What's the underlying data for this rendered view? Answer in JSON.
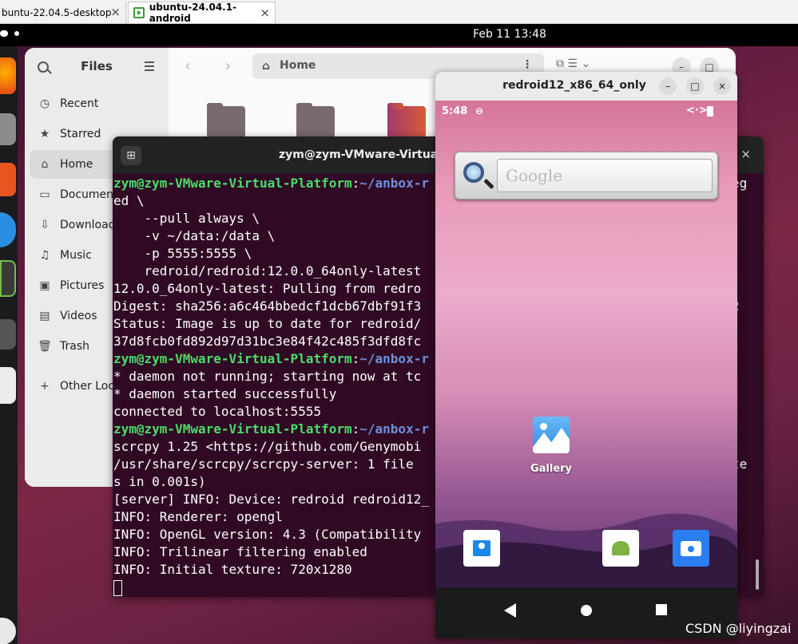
{
  "vmware_tabs": [
    {
      "label": "buntu-22.04.5-desktop",
      "close": "×"
    },
    {
      "label": "ubuntu-24.04.1-android",
      "close": "×"
    }
  ],
  "topbar": {
    "clock": "Feb 11  13:48"
  },
  "files": {
    "title": "Files",
    "path": "Home",
    "path_menu": "⋮",
    "nav": "‹ ›",
    "view_buttons": "⧉   ☰ ⌄",
    "sidebar": [
      {
        "icon": "recent-icon",
        "glyph": "◷",
        "label": "Recent"
      },
      {
        "icon": "star-icon",
        "glyph": "★",
        "label": "Starred"
      },
      {
        "icon": "home-icon",
        "glyph": "⌂",
        "label": "Home"
      },
      {
        "icon": "document-icon",
        "glyph": "▭",
        "label": "Documen"
      },
      {
        "icon": "download-icon",
        "glyph": "⇩",
        "label": "Download"
      },
      {
        "icon": "music-icon",
        "glyph": "♫",
        "label": "Music"
      },
      {
        "icon": "pictures-icon",
        "glyph": "▣",
        "label": "Pictures"
      },
      {
        "icon": "videos-icon",
        "glyph": "▤",
        "label": "Videos"
      },
      {
        "icon": "trash-icon",
        "glyph": "🗑",
        "label": "Trash"
      },
      {
        "icon": "plus-icon",
        "glyph": "+",
        "label": "Other Loc"
      }
    ],
    "window_buttons": {
      "minimize": "–",
      "maximize": "□",
      "close": "×"
    }
  },
  "terminal": {
    "title": "zym@zym-VMware-Virtual-P",
    "new_tab": "⊞",
    "close": "×",
    "lines": [
      {
        "prompt": "zym@zym-VMware-Virtual-Platform",
        "sep": ":",
        "dir": "~/anbox-r",
        "text": ""
      },
      {
        "text": "ed \\"
      },
      {
        "text": "    --pull always \\"
      },
      {
        "text": "    -v ~/data:/data \\"
      },
      {
        "text": "    -p 5555:5555 \\"
      },
      {
        "text": "    redroid/redroid:12.0.0_64only-latest"
      },
      {
        "text": "12.0.0_64only-latest: Pulling from redro"
      },
      {
        "text": "Digest: sha256:a6c464bbedcf1dcb67dbf91f3"
      },
      {
        "text": "Status: Image is up to date for redroid/"
      },
      {
        "text": "37d8fcb0fd892d97d31bc3e84f42c485f3dfd8fc"
      },
      {
        "prompt": "zym@zym-VMware-Virtual-Platform",
        "sep": ":",
        "dir": "~/anbox-r",
        "text": ""
      },
      {
        "text": "* daemon not running; starting now at tc"
      },
      {
        "text": "* daemon started successfully"
      },
      {
        "text": "connected to localhost:5555"
      },
      {
        "prompt": "zym@zym-VMware-Virtual-Platform",
        "sep": ":",
        "dir": "~/anbox-r",
        "text": ""
      },
      {
        "text": "scrcpy 1.25 <https://github.com/Genymobi"
      },
      {
        "text": "/usr/share/scrcpy/scrcpy-server: 1 file"
      },
      {
        "text": "s in 0.001s)"
      },
      {
        "text": "[server] INFO: Device: redroid redroid12_"
      },
      {
        "text": "INFO: Renderer: opengl"
      },
      {
        "text": "INFO: OpenGL version: 4.3 (Compatibility"
      },
      {
        "text": "INFO: Trilinear filtering enabled"
      },
      {
        "text": "INFO: Initial texture: 720x1280"
      }
    ],
    "right_edge": [
      "eg",
      "",
      "",
      "",
      "",
      "",
      "",
      "2",
      "",
      "",
      "",
      "",
      "",
      "",
      "",
      "",
      "te",
      "",
      "",
      "",
      "",
      "",
      ""
    ]
  },
  "scrcpy": {
    "title": "redroid12_x86_64_only",
    "buttons": {
      "minimize": "–",
      "maximize": "□",
      "close": "×"
    },
    "status": {
      "time": "5:48",
      "sim": "⊖",
      "arrows": "<·>"
    },
    "search_placeholder": "Google",
    "gallery_label": "Gallery"
  },
  "watermark": "CSDN @liyingzai"
}
